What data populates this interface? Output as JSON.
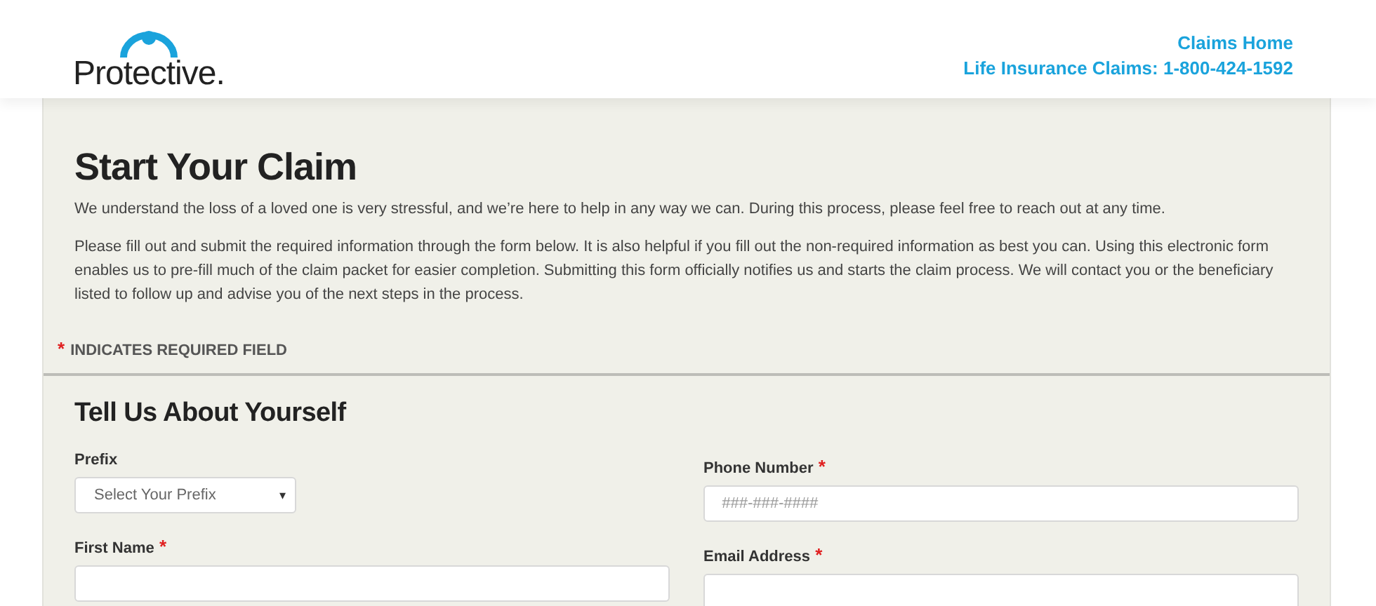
{
  "header": {
    "logo": "Protective.",
    "links": [
      "Claims Home",
      "Life Insurance Claims: 1-800-424-1592"
    ]
  },
  "intro": {
    "title": "Start Your Claim",
    "paragraphs": [
      "We understand the loss of a loved one is very stressful, and we’re here to help in any way we can. During this process, please feel free to reach out at any time.",
      "Please fill out and submit the required information through the form below. It is also helpful if you fill out the non-required information as best you can. Using this electronic form enables us to pre-fill much of the claim packet for easier completion. Submitting this form officially notifies us and starts the claim process. We will contact you or the beneficiary listed to follow up and advise you of the next steps in the process."
    ],
    "required_mark": "*",
    "required_note": "INDICATES REQUIRED FIELD"
  },
  "section": {
    "title": "Tell Us About Yourself",
    "columns": [
      [
        {
          "kind": "select",
          "label": "Prefix",
          "required": false,
          "placeholder": "Select Your Prefix",
          "caret": "▾"
        },
        {
          "kind": "text",
          "label": "First Name",
          "required": true
        }
      ],
      [
        {
          "kind": "text",
          "label": "Phone Number",
          "required": true,
          "placeholder": "###-###-####"
        },
        {
          "kind": "text",
          "label": "Email Address",
          "required": true
        }
      ]
    ]
  }
}
